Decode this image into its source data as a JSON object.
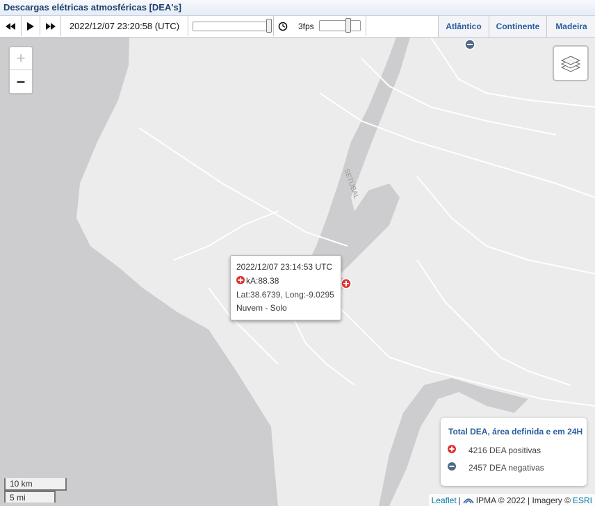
{
  "title": "Descargas elétricas atmosféricas [DEA's]",
  "toolbar": {
    "timestamp": "2022/12/07 23:20:58 (UTC)",
    "fps_label": "3fps",
    "time_slider_position": 1.0,
    "fps_slider_position": 0.72
  },
  "regions": [
    "Atlântico",
    "Continente",
    "Madeira"
  ],
  "map": {
    "place_label": "SETÚBAL",
    "zoom_in": "+",
    "zoom_out": "–"
  },
  "popup": {
    "time": "2022/12/07 23:14:53 UTC",
    "ka": "kA:88.38",
    "coords": "Lat:38.6739, Long:-9.0295",
    "type": "Nuvem - Solo"
  },
  "legend": {
    "title": "Total DEA, área definida e em 24H",
    "positive": "4216 DEA positivas",
    "negative": "2457 DEA negativas"
  },
  "scale": {
    "metric": "10 km",
    "imperial": "5 mi"
  },
  "attribution": {
    "leaflet": "Leaflet",
    "sep1": "|",
    "ipma": "IPMA © 2022 | Imagery ©",
    "esri": "ESRI"
  },
  "colors": {
    "positive": "#e03030",
    "negative": "#4f6a86",
    "accent": "#2a5d9e"
  }
}
